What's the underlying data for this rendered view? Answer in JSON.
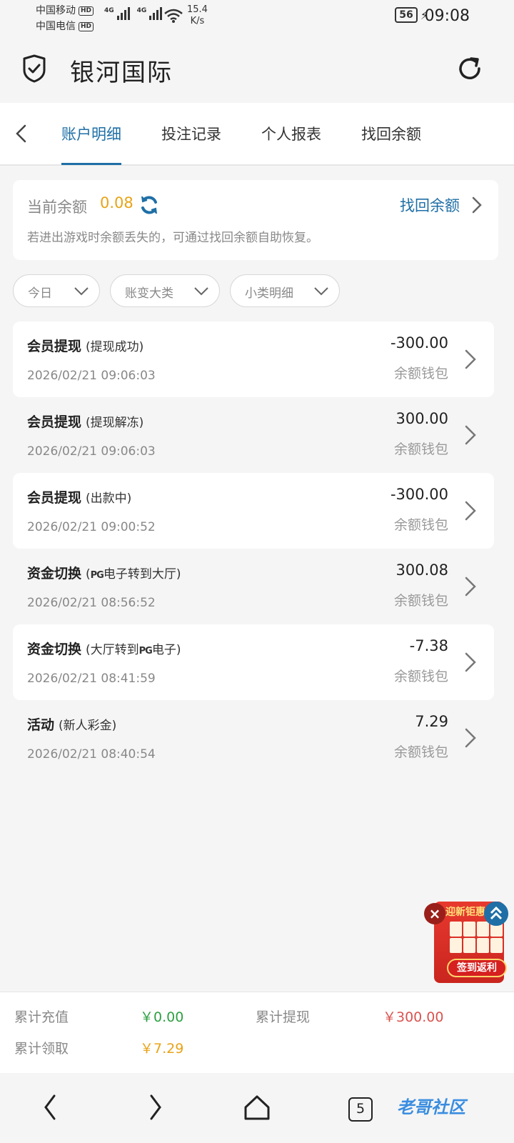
{
  "status_bar": {
    "carrier1": "中国移动",
    "carrier2": "中国电信",
    "hd": "HD",
    "net1": "4G",
    "net2": "4G",
    "speed_value": "15.4",
    "speed_unit": "K/s",
    "battery": "56",
    "time": "09:08"
  },
  "header": {
    "title": "银河国际",
    "left_icon": "shield-check-icon",
    "right_icon": "refresh-icon"
  },
  "tabs": {
    "items": [
      "账户明细",
      "投注记录",
      "个人报表",
      "找回余额"
    ],
    "active_index": 0
  },
  "balance": {
    "label": "当前余额",
    "value": "0.08",
    "recover_link": "找回余额",
    "note": "若进出游戏时余额丢失的，可通过找回余额自助恢复。"
  },
  "filters": [
    "今日",
    "账变大类",
    "小类明细"
  ],
  "transactions": [
    {
      "title": "会员提现",
      "sub": "(提现成功)",
      "time": "2026/02/21 09:06:03",
      "amount": "-300.00",
      "wallet": "余额钱包"
    },
    {
      "title": "会员提现",
      "sub": "(提现解冻)",
      "time": "2026/02/21 09:06:03",
      "amount": "300.00",
      "wallet": "余额钱包"
    },
    {
      "title": "会员提现",
      "sub": "(出款中)",
      "time": "2026/02/21 09:00:52",
      "amount": "-300.00",
      "wallet": "余额钱包"
    },
    {
      "title": "资金切换",
      "sub_pre": "(",
      "sub_pg": "PG",
      "sub_post": "电子转到大厅)",
      "time": "2026/02/21 08:56:52",
      "amount": "300.08",
      "wallet": "余额钱包"
    },
    {
      "title": "资金切换",
      "sub_pre": "(大厅转到",
      "sub_pg": "PG",
      "sub_post": "电子)",
      "time": "2026/02/21 08:41:59",
      "amount": "-7.38",
      "wallet": "余额钱包"
    },
    {
      "title": "活动",
      "sub": "(新人彩金)",
      "time": "2026/02/21 08:40:54",
      "amount": "7.29",
      "wallet": "余额钱包"
    }
  ],
  "promo": {
    "title": "迎新钜惠",
    "button": "签到返利",
    "close": "×"
  },
  "summary": {
    "recharge_label": "累计充值",
    "recharge_value": "￥0.00",
    "withdraw_label": "累计提现",
    "withdraw_value": "￥300.00",
    "claim_label": "累计领取",
    "claim_value": "￥7.29"
  },
  "navbar": {
    "tab_count": "5",
    "watermark": "老哥社区"
  },
  "colors": {
    "accent": "#1f6fa6",
    "balance": "#e8a317",
    "recharge": "#2ea043",
    "withdraw": "#d9534f",
    "claim": "#e8a317"
  }
}
